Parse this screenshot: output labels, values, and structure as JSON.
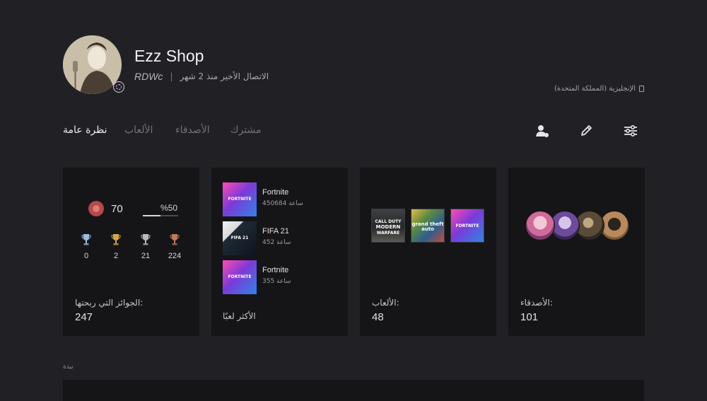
{
  "profile": {
    "name": "Ezz Shop",
    "online_id": "RDWc",
    "separator": "|",
    "last_online": "الاتصال الأخير منذ 2 شهر",
    "language": "الإنجليزية (المملكة المتحدة)"
  },
  "tabs": [
    {
      "label": "نظرة عامة",
      "active": true
    },
    {
      "label": "الألعاب",
      "active": false
    },
    {
      "label": "الأصدقاء",
      "active": false
    },
    {
      "label": "مشترك",
      "active": false
    }
  ],
  "actions": {
    "add_friend_icon": "add-friend-icon",
    "edit_icon": "pencil-icon",
    "settings_icon": "sliders-icon"
  },
  "trophies": {
    "level": "70",
    "progress_text": "%50",
    "progress_fraction": 0.5,
    "platinum": "0",
    "gold": "2",
    "silver": "21",
    "bronze": "224",
    "label": "الجوائز التي ربحتها:",
    "total": "247"
  },
  "most_played": {
    "label": "الأكثر لعبًا",
    "items": [
      {
        "title": "Fortnite",
        "hours": "450684 ساعة"
      },
      {
        "title": "FIFA 21",
        "hours": "452 ساعة"
      },
      {
        "title": "Fortnite",
        "hours": "355 ساعة"
      }
    ]
  },
  "games": {
    "label": "الألعاب:",
    "count": "48",
    "tile_texts": {
      "cod_line1": "CALL DUTY",
      "cod_line2": "MODERN",
      "cod_line3": "WARFARE",
      "gta": "grand theft auto",
      "fortnite": "FORTNITE",
      "fifa": "FIFA 21"
    }
  },
  "friends": {
    "label": "الأصدقاء:",
    "count": "101"
  },
  "bio": {
    "label": "نبذة"
  },
  "colors": {
    "background": "#212125",
    "card": "#151518",
    "text_primary": "#e6e6e8",
    "text_muted": "#707077"
  }
}
